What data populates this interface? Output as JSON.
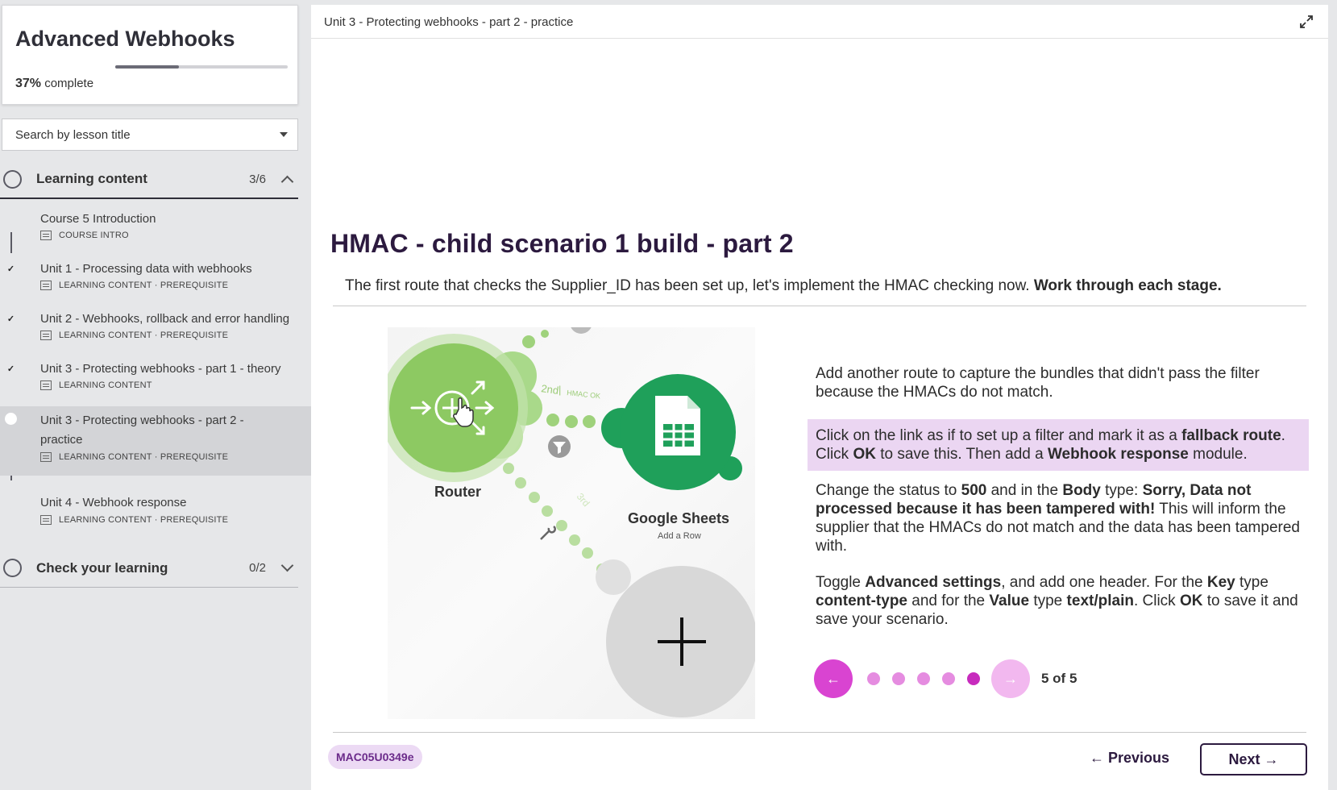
{
  "course": {
    "title": "Advanced Webhooks",
    "progress_percent": 37,
    "progress_value": "37%",
    "progress_suffix": " complete"
  },
  "search": {
    "placeholder": "Search by lesson title"
  },
  "sections": [
    {
      "label": "Learning content",
      "count": "3/6",
      "expanded": true
    },
    {
      "label": "Check your learning",
      "count": "0/2",
      "expanded": false
    }
  ],
  "lessons": [
    {
      "title": "Course 5 Introduction",
      "meta": "COURSE INTRO",
      "done": false
    },
    {
      "title": "Unit 1 - Processing data with webhooks",
      "meta": "LEARNING CONTENT · PREREQUISITE",
      "done": true
    },
    {
      "title": "Unit 2 - Webhooks, rollback and error handling",
      "meta": "LEARNING CONTENT · PREREQUISITE",
      "done": true
    },
    {
      "title": "Unit 3 - Protecting webhooks - part 1 - theory",
      "meta": "LEARNING CONTENT",
      "done": true
    },
    {
      "title": "Unit 3 - Protecting webhooks - part 2 - practice",
      "meta": "LEARNING CONTENT · PREREQUISITE",
      "done": false,
      "active": true
    },
    {
      "title": "Unit 4 - Webhook response",
      "meta": "LEARNING CONTENT · PREREQUISITE",
      "done": false
    }
  ],
  "check_mark": "✓",
  "topbar": {
    "breadcrumb": "Unit 3 - Protecting webhooks - part 2 - practice"
  },
  "content": {
    "heading": "HMAC - child scenario 1 build - part 2",
    "intro": "The first route that checks the Supplier_ID has been set up, let's implement the HMAC checking now.",
    "intro_bold": "Work through each stage."
  },
  "illustration": {
    "router_label": "Router",
    "sheets_label": "Google Sheets",
    "sheets_sub": "Add a Row",
    "route_2": "2nd",
    "route_2_filter": "HMAC OK",
    "route_3": "3rd"
  },
  "steps": {
    "s1": "Add another route to capture the bundles that didn't pass the filter because the HMACs do not match.",
    "s2_a": "Click on the link as if to set up a filter and mark it as a ",
    "s2_b": "fallback route",
    "s2_c": ". Click ",
    "s2_d": "OK",
    "s2_e": " to save this. Then add a ",
    "s2_f": "Webhook response",
    "s2_g": " module.",
    "s3_a": "Change the status to ",
    "s3_b": "500",
    "s3_c": " and in the ",
    "s3_d": "Body",
    "s3_e": " type: ",
    "s3_f": "Sorry, Data not processed because it has been tampered with!",
    "s3_g": " This will inform the supplier that the HMACs do not match and the data has been tampered with.",
    "s4_a": "Toggle ",
    "s4_b": "Advanced settings",
    "s4_c": ", and add one header. For the ",
    "s4_d": "Key",
    "s4_e": " type ",
    "s4_f": "content-type",
    "s4_g": " and for the ",
    "s4_h": "Value",
    "s4_i": " type ",
    "s4_j": "text/plain",
    "s4_k": ". Click ",
    "s4_l": "OK",
    "s4_m": " to save it and save your scenario."
  },
  "carousel": {
    "prev_icon": "←",
    "next_icon": "→",
    "counter": "5 of 5",
    "current": 5,
    "total": 5
  },
  "footer": {
    "tag": "MAC05U0349e",
    "previous": "← Previous",
    "next": "Next →"
  },
  "colors": {
    "accent": "#d944d1",
    "accent_active": "#c72bbd",
    "heading": "#2c1a3f",
    "highlight": "#ebd6f2",
    "router_green": "#8dc962",
    "sheets_green": "#1fa05a"
  }
}
